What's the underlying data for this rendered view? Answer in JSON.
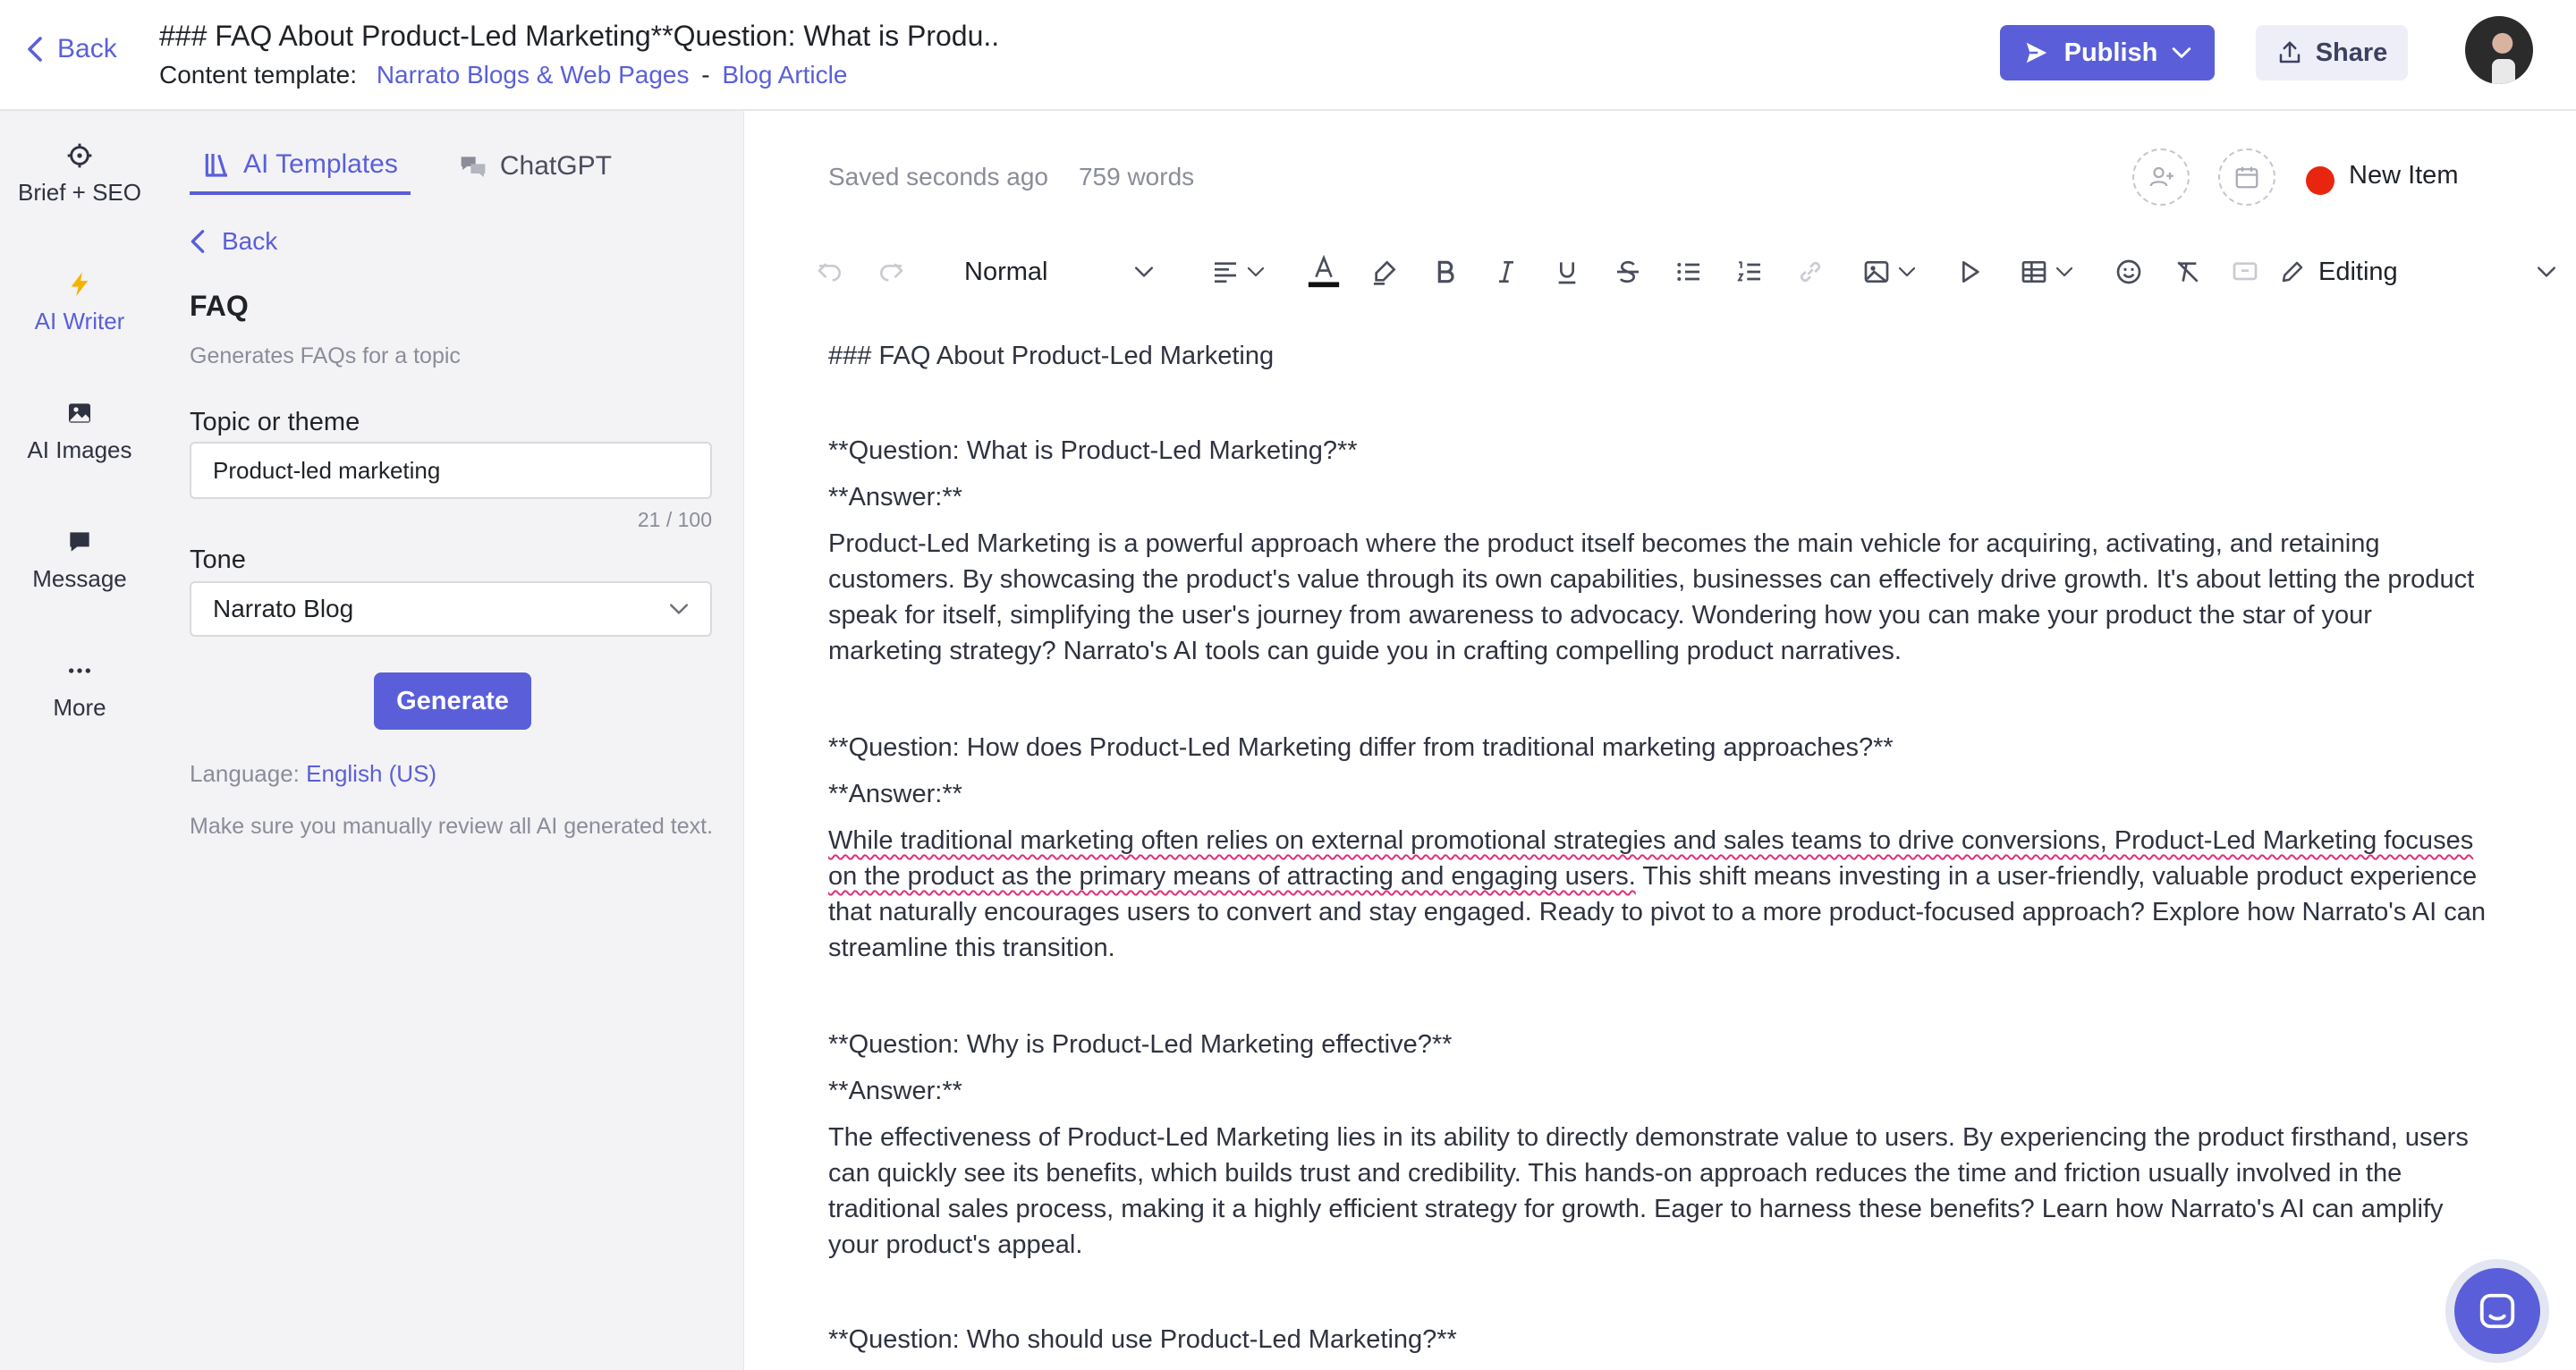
{
  "header": {
    "back_label": "Back",
    "doc_title": "### FAQ About Product-Led Marketing**Question: What is Produ..",
    "template_prefix": "Content template:",
    "template_category": "Narrato Blogs & Web Pages",
    "template_separator": "-",
    "template_name": "Blog Article",
    "publish_label": "Publish",
    "share_label": "Share",
    "accent_color": "#5a5fd9"
  },
  "leftnav": {
    "items": [
      {
        "label": "Brief + SEO",
        "icon": "crosshair-icon"
      },
      {
        "label": "AI Writer",
        "icon": "lightning-icon"
      },
      {
        "label": "AI Images",
        "icon": "image-icon"
      },
      {
        "label": "Message",
        "icon": "chat-bubble-icon"
      },
      {
        "label": "More",
        "icon": "ellipsis-icon"
      }
    ]
  },
  "toolpanel": {
    "tabs": [
      {
        "label": "AI Templates",
        "icon": "templates-icon"
      },
      {
        "label": "ChatGPT",
        "icon": "chat-icon"
      }
    ],
    "back_label": "Back",
    "heading": "FAQ",
    "subheading": "Generates FAQs for a topic",
    "topic_label": "Topic or theme",
    "topic_value": "Product-led marketing",
    "char_count": "21 / 100",
    "tone_label": "Tone",
    "tone_value": "Narrato Blog",
    "generate_label": "Generate",
    "language_prefix": "Language:",
    "language_value": "English (US)",
    "review_note": "Make sure you manually review all AI generated text."
  },
  "editor": {
    "saved_status": "Saved seconds ago",
    "word_count": "759 words",
    "status_label": "New Item",
    "status_color": "#e8260f",
    "style_value": "Normal",
    "mode_value": "Editing",
    "content": {
      "heading": "### FAQ About Product-Led Marketing",
      "q1": "**Question: What is Product-Led Marketing?**",
      "a1_label": "**Answer:**",
      "a1": "Product-Led Marketing is a powerful approach where the product itself becomes the main vehicle for acquiring, activating, and retaining customers. By showcasing the product's value through its own capabilities, businesses can effectively drive growth. It's about letting the product speak for itself, simplifying the user's journey from awareness to advocacy. Wondering how you can make your product the star of your marketing strategy? Narrato's AI tools can guide you in crafting compelling product narratives.",
      "q2": "**Question: How does Product-Led Marketing differ from traditional marketing approaches?**",
      "a2_label": "**Answer:**",
      "a2_flagged": "While traditional marketing often relies on external promotional strategies and sales teams to drive conversions, Product-Led Marketing focuses on the product as the primary means of attracting and engaging users.",
      "a2_rest": " This shift means investing in a user-friendly, valuable product experience that naturally encourages users to convert and stay engaged. Ready to pivot to a more product-focused approach? Explore how Narrato's AI can streamline this transition.",
      "q3": "**Question: Why is Product-Led Marketing effective?**",
      "a3_label": "**Answer:**",
      "a3": "The effectiveness of Product-Led Marketing lies in its ability to directly demonstrate value to users. By experiencing the product firsthand, users can quickly see its benefits, which builds trust and credibility. This hands-on approach reduces the time and friction usually involved in the traditional sales process, making it a highly efficient strategy for growth. Eager to harness these benefits? Learn how Narrato's AI can amplify your product's appeal.",
      "q4": "**Question: Who should use Product-Led Marketing?**"
    }
  }
}
